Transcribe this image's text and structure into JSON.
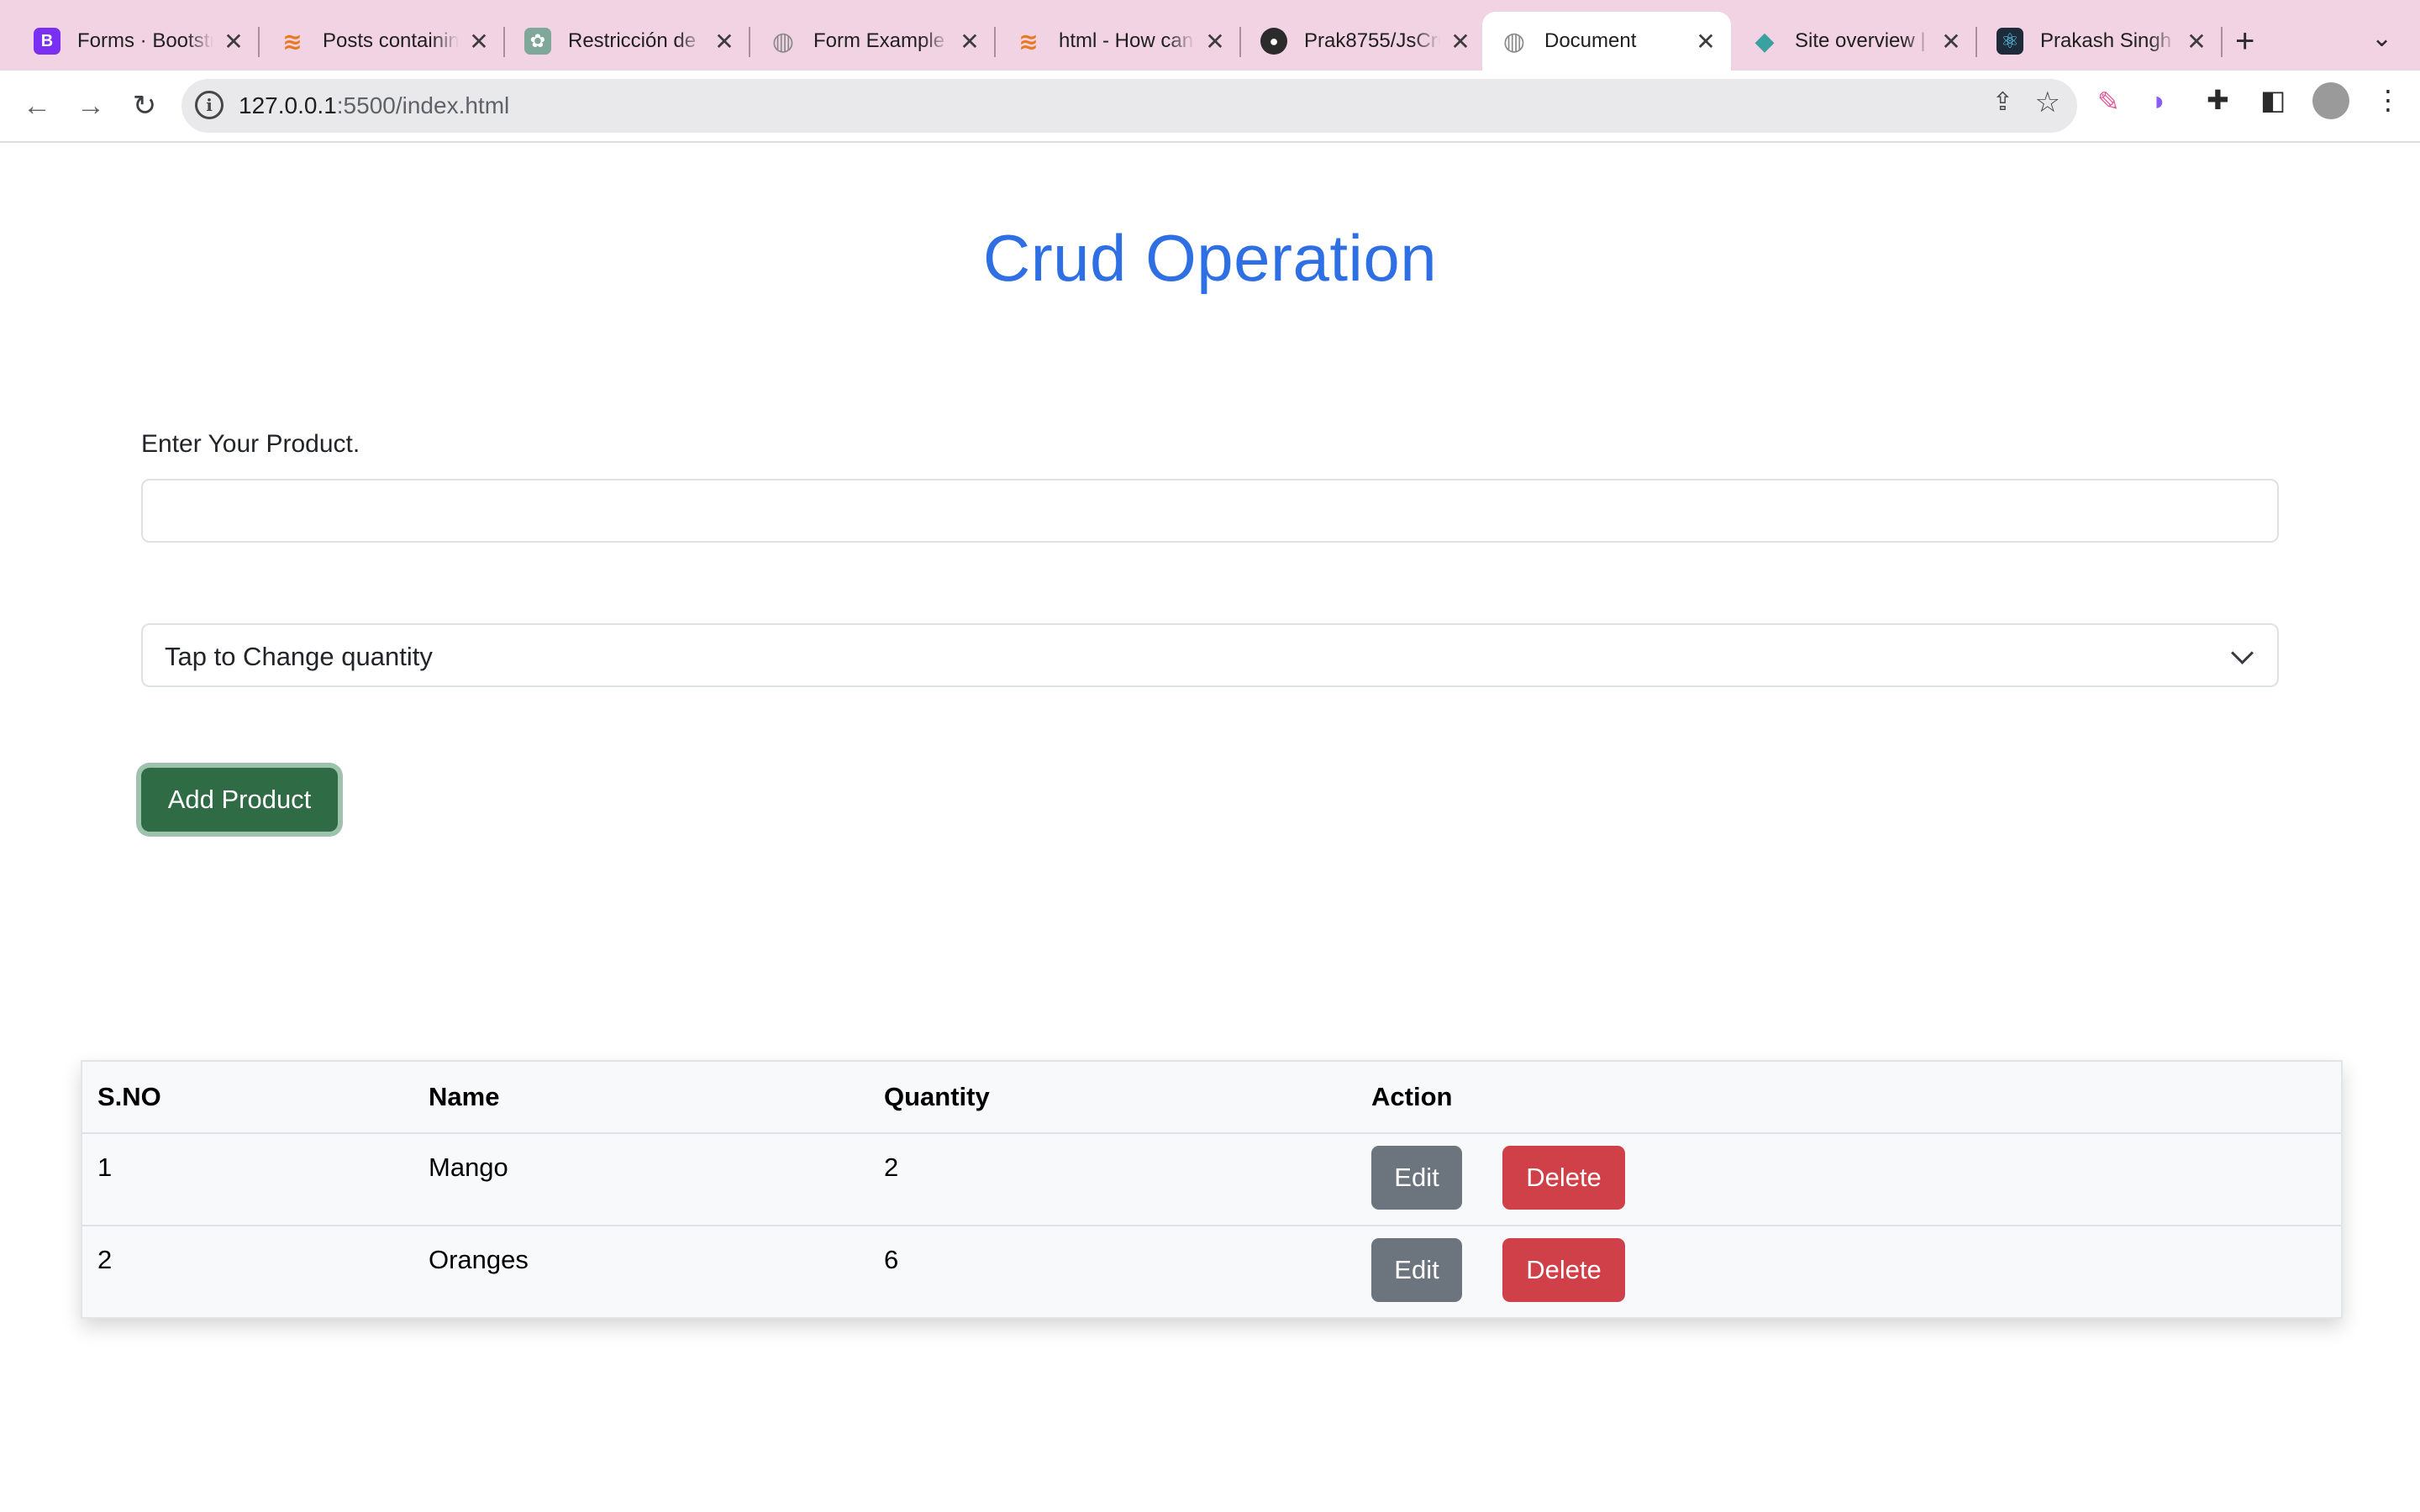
{
  "browser": {
    "tabs": [
      {
        "title": "Forms · Bootstrap",
        "icon": "bootstrap-icon",
        "active": false
      },
      {
        "title": "Posts containing",
        "icon": "stackoverflow-icon",
        "active": false
      },
      {
        "title": "Restricción de",
        "icon": "openai-icon",
        "active": false
      },
      {
        "title": "Form Example",
        "icon": "globe-icon",
        "active": false
      },
      {
        "title": "html - How can",
        "icon": "stackoverflow-icon",
        "active": false
      },
      {
        "title": "Prak8755/JsCrud",
        "icon": "github-icon",
        "active": false
      },
      {
        "title": "Document",
        "icon": "globe-icon",
        "active": true
      },
      {
        "title": "Site overview |",
        "icon": "netlify-icon",
        "active": false
      },
      {
        "title": "Prakash Singh",
        "icon": "react-icon",
        "active": false
      }
    ],
    "new_tab": "+",
    "url_host": "127.0.0.1",
    "url_path": ":5500/index.html"
  },
  "page": {
    "heading": "Crud Operation",
    "product_label": "Enter Your Product.",
    "product_value": "",
    "quantity_select": "Tap to Change quantity",
    "add_button": "Add Product"
  },
  "table": {
    "headers": [
      "S.NO",
      "Name",
      "Quantity",
      "Action"
    ],
    "rows": [
      {
        "sno": "1",
        "name": "Mango",
        "qty": "2",
        "edit": "Edit",
        "delete": "Delete"
      },
      {
        "sno": "2",
        "name": "Oranges",
        "qty": "6",
        "edit": "Edit",
        "delete": "Delete"
      }
    ]
  },
  "colors": {
    "heading": "#2f6fe4",
    "add_button": "#2f6b45",
    "edit_button": "#6c757d",
    "delete_button": "#d04048",
    "tabbar": "#f1d3e3"
  }
}
